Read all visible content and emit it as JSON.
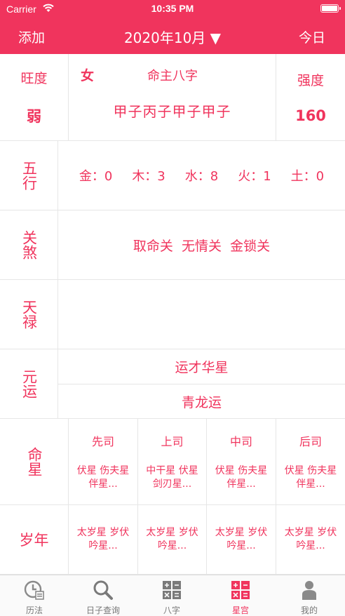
{
  "status": {
    "carrier": "Carrier",
    "time": "10:35 PM"
  },
  "nav": {
    "add": "添加",
    "title": "2020年10月 ▼",
    "today": "今日"
  },
  "header": {
    "strength_label": "旺度",
    "strength_value": "弱",
    "gender": "女",
    "chart_title": "命主八字",
    "bazi": "甲子丙子甲子甲子",
    "degree_label": "强度",
    "degree_value": "160"
  },
  "wuxing": {
    "label": "五行",
    "items": [
      "金：0",
      "木：3",
      "水：8",
      "火：1",
      "土：0"
    ]
  },
  "guansha": {
    "label": "关煞",
    "value": "取命关  无情关  金锁关"
  },
  "tianlu": {
    "label": "天禄",
    "value": ""
  },
  "yuanyun": {
    "label": "元运",
    "line1": "运才华星",
    "line2": "青龙运"
  },
  "mingxing": {
    "label": "命星",
    "columns": [
      {
        "head": "先司",
        "text": "伏星  伤夫星  伴星..."
      },
      {
        "head": "上司",
        "text": "中干星  伏星  剑刃星..."
      },
      {
        "head": "中司",
        "text": "伏星  伤夫星  伴星..."
      },
      {
        "head": "后司",
        "text": "伏星  伤夫星  伴星..."
      }
    ]
  },
  "suinian": {
    "label": "岁年",
    "columns": [
      {
        "text": "太岁星  岁伏吟星..."
      },
      {
        "text": "太岁星  岁伏吟星..."
      },
      {
        "text": "太岁星  岁伏吟星..."
      },
      {
        "text": "太岁星  岁伏吟星..."
      }
    ]
  },
  "tabs": [
    {
      "label": "历法",
      "icon": "clock-calendar-icon"
    },
    {
      "label": "日子查询",
      "icon": "search-icon"
    },
    {
      "label": "八字",
      "icon": "grid-icon"
    },
    {
      "label": "星宫",
      "icon": "grid-icon",
      "active": true
    },
    {
      "label": "我的",
      "icon": "person-icon"
    }
  ],
  "colors": {
    "accent": "#f0345d",
    "inactive": "#777777"
  }
}
